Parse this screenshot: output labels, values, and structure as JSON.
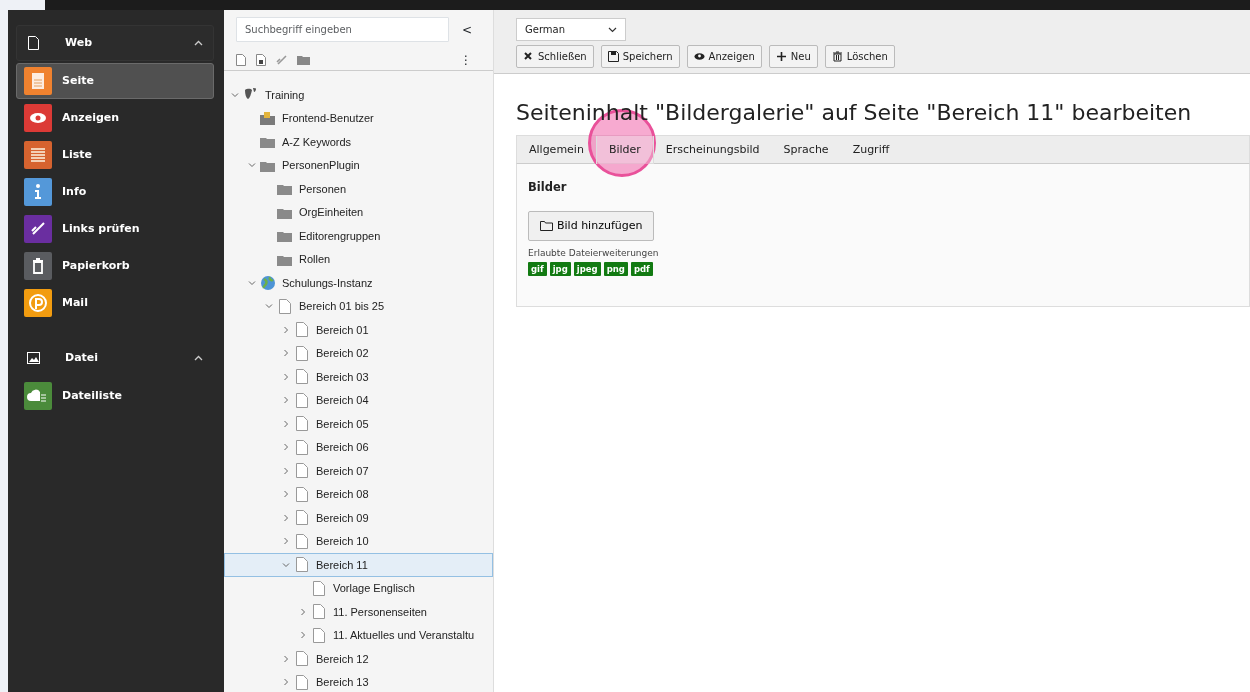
{
  "modules": [
    {
      "label": "Web",
      "kind": "page",
      "expanded": true,
      "items": [
        {
          "label": "Seite",
          "kind": "page",
          "color": "#f0822f",
          "selected": true
        },
        {
          "label": "Anzeigen",
          "kind": "eye",
          "color": "#dc3a36",
          "selected": false
        },
        {
          "label": "Liste",
          "kind": "list",
          "color": "#d6632f",
          "selected": false
        },
        {
          "label": "Info",
          "kind": "info",
          "color": "#5498d9",
          "selected": false
        },
        {
          "label": "Links prüfen",
          "kind": "link",
          "color": "#6a2ea0",
          "selected": false
        },
        {
          "label": "Papierkorb",
          "kind": "trash",
          "color": "#5a5c60",
          "selected": false
        },
        {
          "label": "Mail",
          "kind": "mail",
          "color": "#f29c10",
          "selected": false
        }
      ]
    },
    {
      "label": "Datei",
      "kind": "image",
      "expanded": true,
      "items": [
        {
          "label": "Dateiliste",
          "kind": "cloud",
          "color": "#4b8b3b",
          "selected": false
        }
      ]
    }
  ],
  "tree_panel": {
    "search": {
      "placeholder": "Suchbegriff eingeben"
    },
    "collapse": "<",
    "more": "⋮",
    "tree": [
      {
        "label": "Training",
        "kind": "root",
        "expanded": true,
        "selected": false,
        "children": [
          {
            "label": "Frontend-Benutzer",
            "kind": "folder-user",
            "selected": false
          },
          {
            "label": "A-Z Keywords",
            "kind": "folder",
            "selected": false
          },
          {
            "label": "PersonenPlugin",
            "kind": "folder",
            "expanded": true,
            "selected": false,
            "children": [
              {
                "label": "Personen",
                "kind": "folder",
                "selected": false
              },
              {
                "label": "OrgEinheiten",
                "kind": "folder",
                "selected": false
              },
              {
                "label": "Editorengruppen",
                "kind": "folder",
                "selected": false
              },
              {
                "label": "Rollen",
                "kind": "folder",
                "selected": false
              }
            ]
          },
          {
            "label": "Schulungs-Instanz",
            "kind": "globe",
            "expanded": true,
            "selected": false,
            "children": [
              {
                "label": "Bereich 01 bis 25",
                "kind": "page",
                "expanded": true,
                "selected": false,
                "children": [
                  {
                    "label": "Bereich 01",
                    "kind": "page",
                    "expanded": false,
                    "selected": false
                  },
                  {
                    "label": "Bereich 02",
                    "kind": "page",
                    "expanded": false,
                    "selected": false
                  },
                  {
                    "label": "Bereich 03",
                    "kind": "page",
                    "expanded": false,
                    "selected": false
                  },
                  {
                    "label": "Bereich 04",
                    "kind": "page",
                    "expanded": false,
                    "selected": false
                  },
                  {
                    "label": "Bereich 05",
                    "kind": "page",
                    "expanded": false,
                    "selected": false
                  },
                  {
                    "label": "Bereich 06",
                    "kind": "page",
                    "expanded": false,
                    "selected": false
                  },
                  {
                    "label": "Bereich 07",
                    "kind": "page",
                    "expanded": false,
                    "selected": false
                  },
                  {
                    "label": "Bereich 08",
                    "kind": "page",
                    "expanded": false,
                    "selected": false
                  },
                  {
                    "label": "Bereich 09",
                    "kind": "page",
                    "expanded": false,
                    "selected": false
                  },
                  {
                    "label": "Bereich 10",
                    "kind": "page",
                    "expanded": false,
                    "selected": false
                  },
                  {
                    "label": "Bereich 11",
                    "kind": "page",
                    "expanded": true,
                    "selected": true,
                    "children": [
                      {
                        "label": "Vorlage Englisch",
                        "kind": "page",
                        "selected": false
                      },
                      {
                        "label": "11. Personenseiten",
                        "kind": "page",
                        "expanded": false,
                        "selected": false
                      },
                      {
                        "label": "11. Aktuelles und Veranstaltu",
                        "kind": "page",
                        "expanded": false,
                        "selected": false
                      }
                    ]
                  },
                  {
                    "label": "Bereich 12",
                    "kind": "page",
                    "expanded": false,
                    "selected": false
                  },
                  {
                    "label": "Bereich 13",
                    "kind": "page",
                    "expanded": false,
                    "selected": false
                  }
                ]
              }
            ]
          }
        ]
      }
    ]
  },
  "editor": {
    "language": "German",
    "buttons": [
      {
        "label": "Schließen",
        "kind": "close"
      },
      {
        "label": "Speichern",
        "kind": "save"
      },
      {
        "label": "Anzeigen",
        "kind": "view"
      },
      {
        "label": "Neu",
        "kind": "new"
      },
      {
        "label": "Löschen",
        "kind": "delete"
      }
    ],
    "title": "Seiteninhalt \"Bildergalerie\" auf Seite \"Bereich 11\" bearbeiten",
    "tabs": [
      {
        "label": "Allgemein",
        "selected": false
      },
      {
        "label": "Bilder",
        "selected": true,
        "highlighted": true
      },
      {
        "label": "Erscheinungsbild",
        "selected": false
      },
      {
        "label": "Sprache",
        "selected": false
      },
      {
        "label": "Zugriff",
        "selected": false
      }
    ],
    "section": {
      "heading": "Bilder",
      "add_button": "Bild hinzufügen",
      "hint": "Erlaubte Dateierweiterungen",
      "extensions": [
        "gif",
        "jpg",
        "jpeg",
        "png",
        "pdf"
      ]
    }
  }
}
